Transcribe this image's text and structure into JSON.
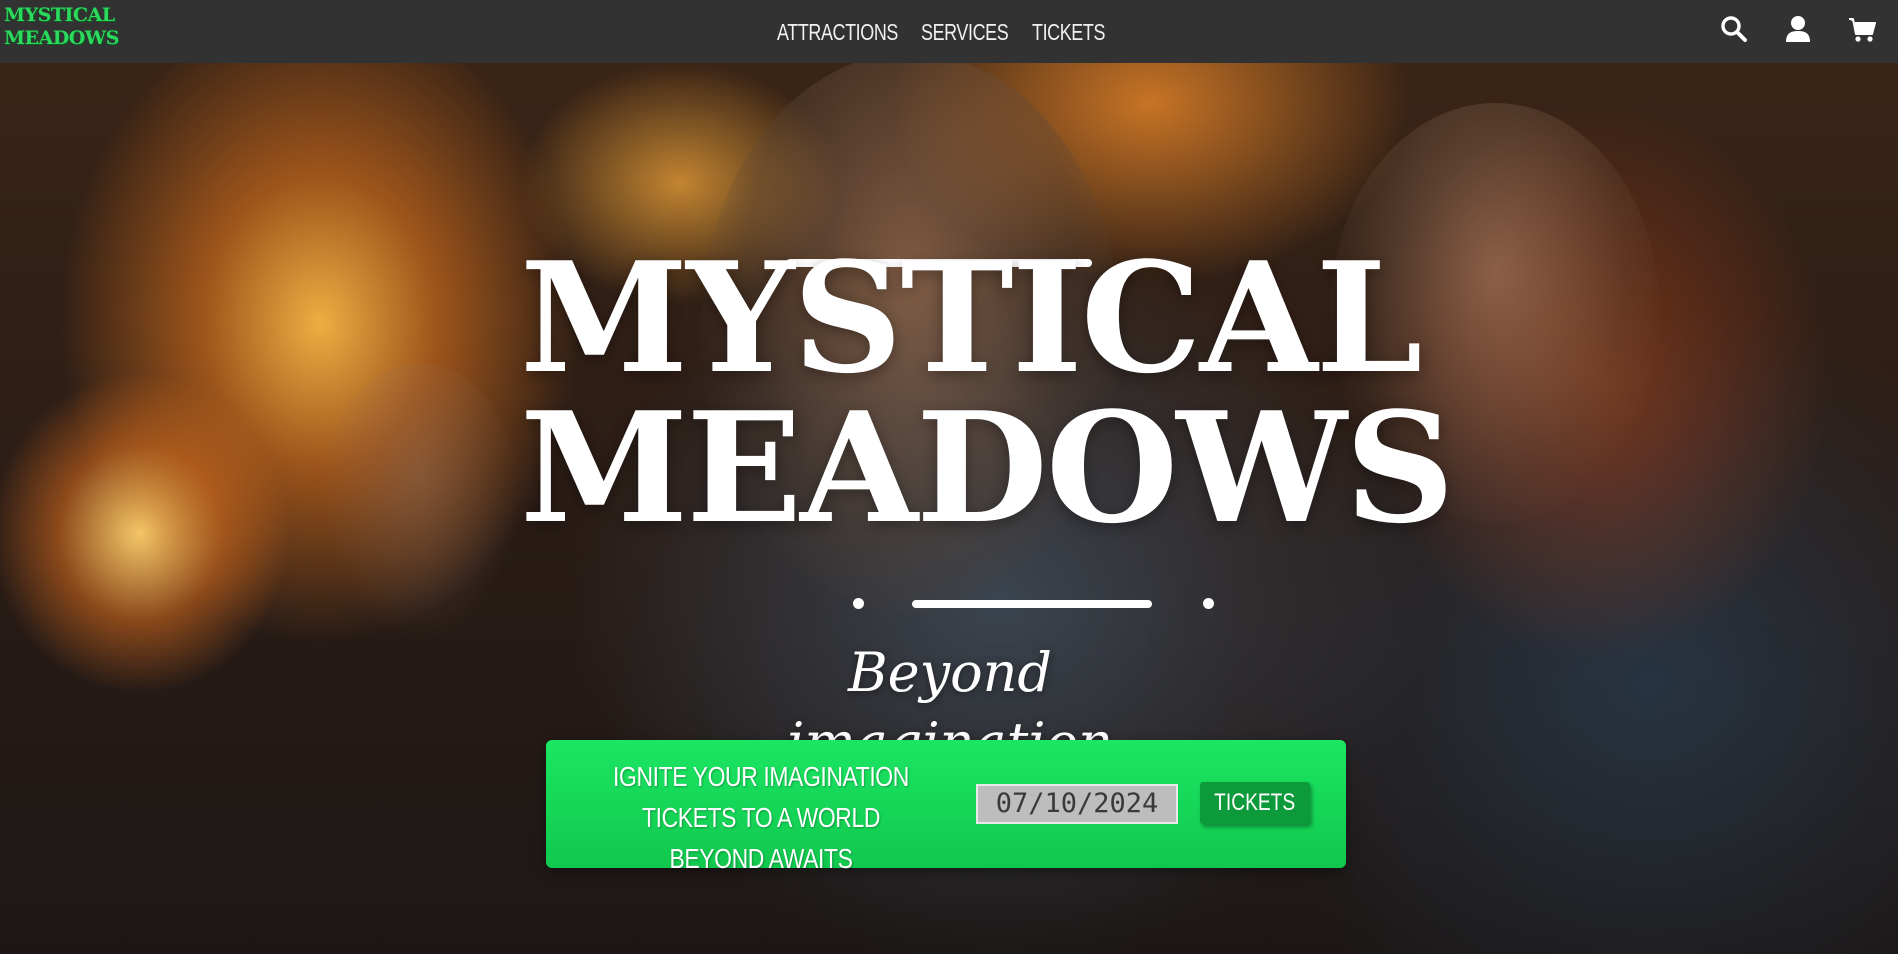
{
  "header": {
    "logo_line1": "MYSTICAL",
    "logo_line2": "MEADOWS",
    "nav": [
      "ATTRACTIONS",
      "SERVICES",
      "TICKETS"
    ],
    "icons": [
      "search-icon",
      "user-icon",
      "cart-icon"
    ]
  },
  "hero": {
    "title_line1": "MYSTICAL",
    "title_line2": "MEADOWS",
    "tagline": "Beyond imagination"
  },
  "banner": {
    "line1": "IGNITE YOUR IMAGINATION",
    "line2": "TICKETS TO A WORLD BEYOND AWAITS",
    "date_value": "07/10/2024",
    "button_label": "TICKETS"
  },
  "colors": {
    "nav_bg": "#323232",
    "brand_green": "#2bd95c",
    "banner_green": "#13d552",
    "button_green": "#0d9a3b"
  }
}
